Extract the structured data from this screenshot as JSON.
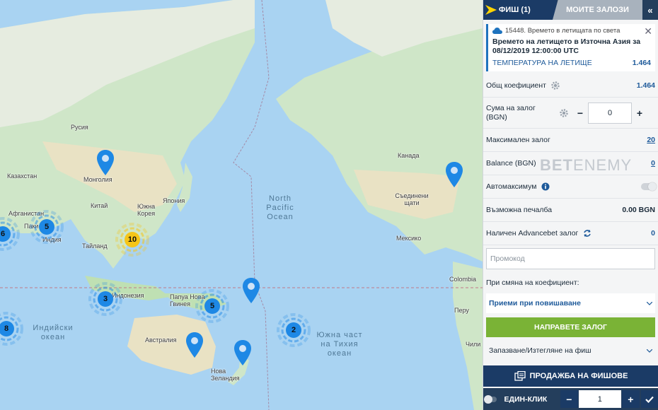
{
  "map": {
    "labels": {
      "russia": "Русия",
      "kazakhstan": "Казахстан",
      "mongolia": "Монголия",
      "afghanistan": "Афганистан",
      "pakistan": "Пакистан",
      "india": "Индия",
      "china": "Китай",
      "south_korea": "Южна Корея",
      "japan": "Япония",
      "thailand": "Тайланд",
      "indonesia": "Индонезия",
      "papua": "Папуа Нова Гвинея",
      "australia": "Австралия",
      "new_zealand": "Нова Зеландия",
      "canada": "Канада",
      "usa": "Съединени щати",
      "mexico": "Мексико",
      "colombia": "Colombia",
      "peru": "Перу",
      "chile": "Чили"
    },
    "oceans": {
      "north_pacific": "North Pacific Ocean",
      "indian": "Индийски океан",
      "south_pacific": "Южна част на Тихия океан"
    },
    "clusters": [
      {
        "id": "cluster-india-west",
        "count": "6",
        "color": "#1e88e5"
      },
      {
        "id": "cluster-india",
        "count": "5",
        "color": "#1e88e5"
      },
      {
        "id": "cluster-china",
        "count": "10",
        "color": "#f5c518"
      },
      {
        "id": "cluster-indonesia",
        "count": "3",
        "color": "#1e88e5"
      },
      {
        "id": "cluster-papua",
        "count": "5",
        "color": "#1e88e5"
      },
      {
        "id": "cluster-indian-ocean",
        "count": "8",
        "color": "#1e88e5"
      },
      {
        "id": "cluster-south-pacific",
        "count": "2",
        "color": "#1e88e5"
      }
    ]
  },
  "panel": {
    "tabs": {
      "slip": "ФИШ (1)",
      "my_bets": "МОИТЕ ЗАЛОЗИ",
      "collapse": "«"
    },
    "bet": {
      "id_text": "15448. Времето в летищата по света",
      "title": "Времето на летището в Източна Азия за 08/12/2019 12:00:00 UTC",
      "selection": "ТЕМПЕРАТУРА НА ЛЕТИЩЕ",
      "odd": "1.464"
    },
    "total_odds_label": "Общ коефициент",
    "total_odds": "1.464",
    "stake_label": "Сума на залог (BGN)",
    "stake_value": "0",
    "max_bet_label": "Максимален залог",
    "max_bet_value": "20",
    "balance_label": "Balance (BGN)",
    "balance_value": "0",
    "automax_label": "Автомаксимум",
    "possible_win_label": "Възможна печалба",
    "possible_win_value": "0.00 BGN",
    "advancebet_label": "Наличен Advancebet залог",
    "advancebet_value": "0",
    "promo_placeholder": "Промокод",
    "odds_change_label": "При смяна на коефициент:",
    "accept_option": "Приеми при повишаване",
    "place_bet": "НАПРАВЕТЕ ЗАЛОГ",
    "save_label": "Запазване/Изтегляне на фиш",
    "sell_label": "ПРОДАЖБА НА ФИШОВЕ",
    "oneclick_label": "ЕДИН-КЛИК",
    "oneclick_value": "1",
    "watermark_bold": "BET",
    "watermark_rest": "ENEMY"
  }
}
